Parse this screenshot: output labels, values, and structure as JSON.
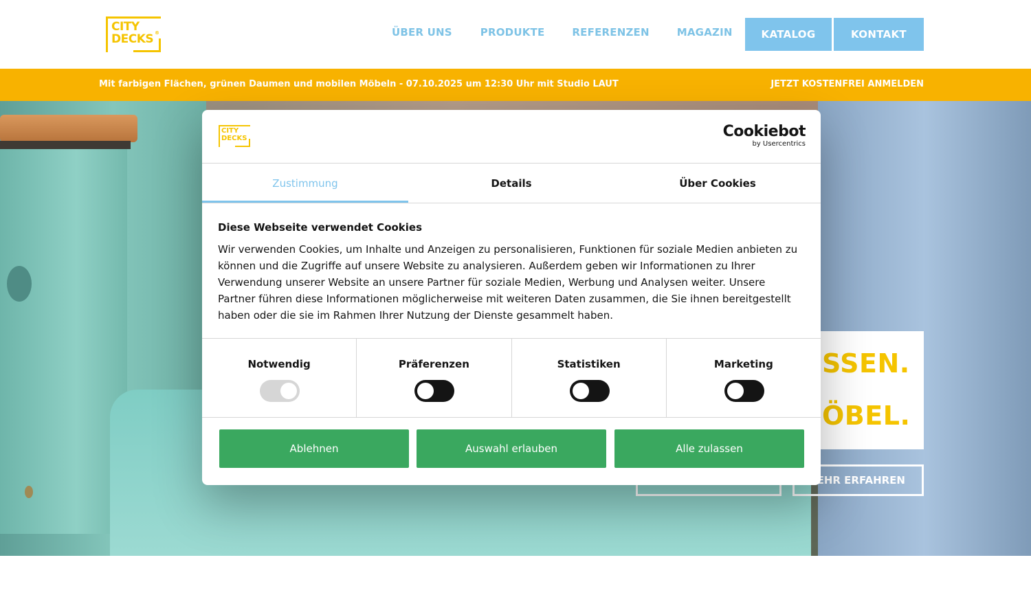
{
  "header": {
    "logo_line1": "CITY",
    "logo_line2": "DECKS",
    "logo_reg": "®",
    "nav": [
      "ÜBER UNS",
      "PRODUKTE",
      "REFERENZEN",
      "MAGAZIN"
    ],
    "katalog_label": "KATALOG",
    "kontakt_label": "KONTAKT",
    "colors": {
      "accent_blue": "#7fc4ec",
      "brand_yellow": "#f5c400"
    }
  },
  "banner": {
    "text": "Mit farbigen Flächen, grünen Daumen und mobilen Möbeln - 07.10.2025 um 12:30 Uhr mit Studio LAUT",
    "cta": "JETZT KOSTENFREI ANMELDEN",
    "color": "#f8b200"
  },
  "hero": {
    "headline_line1": "SSEN.",
    "headline_line2": "ÖBEL.",
    "button_more": "EHR ERFAHREN"
  },
  "cookie_dialog": {
    "logo_line1": "CITY",
    "logo_line2": "DECKS",
    "brand_name": "Cookiebot",
    "brand_sub": "by Usercentrics",
    "tabs": [
      {
        "label": "Zustimmung",
        "active": true
      },
      {
        "label": "Details",
        "active": false
      },
      {
        "label": "Über Cookies",
        "active": false
      }
    ],
    "title": "Diese Webseite verwendet Cookies",
    "body": "Wir verwenden Cookies, um Inhalte und Anzeigen zu personalisieren, Funktionen für soziale Medien anbieten zu können und die Zugriffe auf unsere Website zu analysieren. Außerdem geben wir Informationen zu Ihrer Verwendung unserer Website an unsere Partner für soziale Medien, Werbung und Analysen weiter. Unsere Partner führen diese Informationen möglicherweise mit weiteren Daten zusammen, die Sie ihnen bereitgestellt haben oder die sie im Rahmen Ihrer Nutzung der Dienste gesammelt haben.",
    "toggles": [
      {
        "label": "Notwendig",
        "state": "on-disabled"
      },
      {
        "label": "Präferenzen",
        "state": "off"
      },
      {
        "label": "Statistiken",
        "state": "off"
      },
      {
        "label": "Marketing",
        "state": "off"
      }
    ],
    "buttons": {
      "deny": "Ablehnen",
      "allow_selection": "Auswahl erlauben",
      "allow_all": "Alle zulassen"
    },
    "button_color": "#3aa85f"
  }
}
